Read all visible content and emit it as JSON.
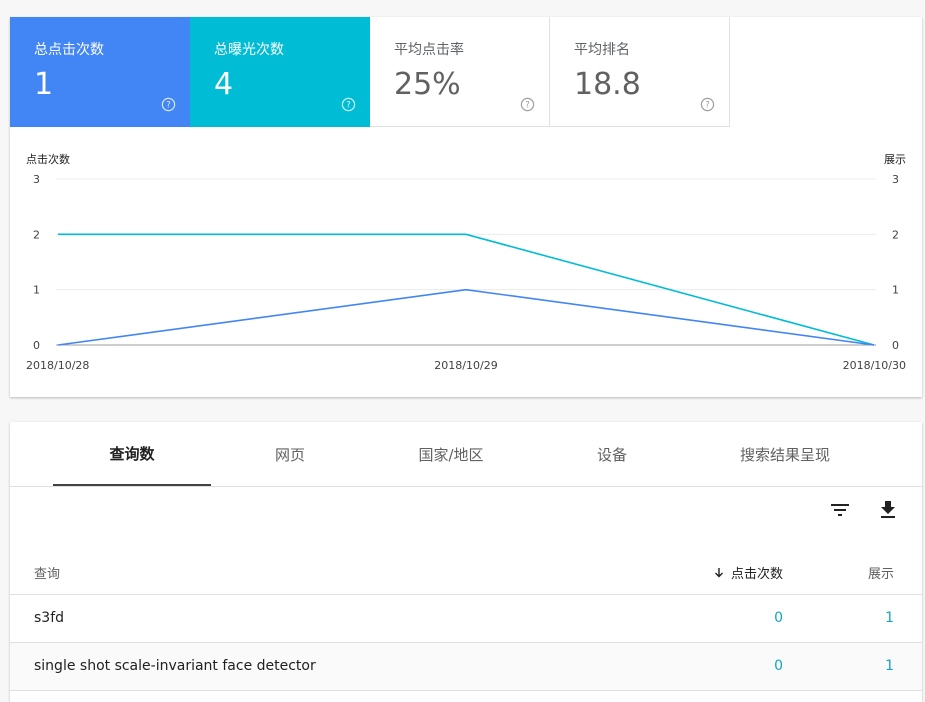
{
  "metrics": [
    {
      "label": "总点击次数",
      "value": "1"
    },
    {
      "label": "总曝光次数",
      "value": "4"
    },
    {
      "label": "平均点击率",
      "value": "25%"
    },
    {
      "label": "平均排名",
      "value": "18.8"
    }
  ],
  "help_icon": "help-circle-icon",
  "colors": {
    "clicks": "#4285f4",
    "impressions": "#00bcd4",
    "link": "#12a5c6"
  },
  "chart_data": {
    "type": "line",
    "x": [
      "2018/10/28",
      "2018/10/29",
      "2018/10/30"
    ],
    "series": [
      {
        "values": [
          0,
          1,
          0
        ],
        "axis": "left"
      },
      {
        "values": [
          2,
          2,
          0
        ],
        "axis": "right"
      }
    ],
    "ylabel_left": "点击次数",
    "ylabel_right": "展示",
    "ylim": [
      0,
      3
    ],
    "yticks": [
      0,
      1,
      2,
      3
    ],
    "grid": true
  },
  "tabs": [
    {
      "label": "查询数",
      "active": true
    },
    {
      "label": "网页"
    },
    {
      "label": "国家/地区"
    },
    {
      "label": "设备"
    },
    {
      "label": "搜索结果呈现"
    }
  ],
  "toolbar": {
    "filter_icon": "filter-icon",
    "download_icon": "download-icon"
  },
  "table": {
    "columns": {
      "query": "查询",
      "clicks": "点击次数",
      "impressions": "展示"
    },
    "sort_icon": "arrow-down-icon",
    "rows": [
      {
        "query": "s3fd",
        "clicks": "0",
        "impressions": "1"
      },
      {
        "query": "single shot scale-invariant face detector",
        "clicks": "0",
        "impressions": "1"
      }
    ]
  }
}
